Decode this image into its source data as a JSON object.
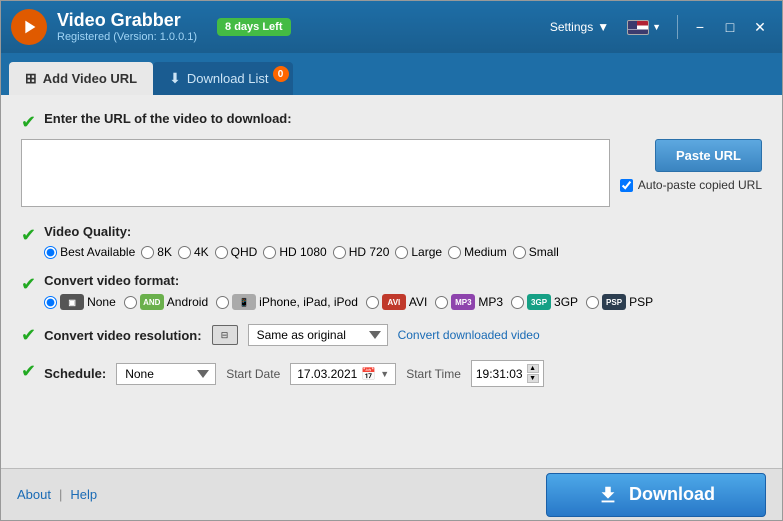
{
  "titlebar": {
    "title": "Video Grabber",
    "subtitle": "Registered (Version: 1.0.0.1)",
    "trial_badge": "8 days Left",
    "settings_label": "Settings",
    "minimize_label": "−",
    "maximize_label": "□",
    "close_label": "✕"
  },
  "tabs": [
    {
      "id": "add-url",
      "label": "Add Video URL",
      "active": true,
      "badge": null
    },
    {
      "id": "download-list",
      "label": "Download List",
      "active": false,
      "badge": "0"
    }
  ],
  "url_section": {
    "label": "Enter the URL of the video to download:",
    "placeholder": "",
    "paste_btn": "Paste URL",
    "auto_paste_label": "Auto-paste copied URL"
  },
  "quality_section": {
    "label": "Video Quality:",
    "options": [
      {
        "id": "best",
        "label": "Best Available",
        "checked": true
      },
      {
        "id": "8k",
        "label": "8K",
        "checked": false
      },
      {
        "id": "4k",
        "label": "4K",
        "checked": false
      },
      {
        "id": "qhd",
        "label": "QHD",
        "checked": false
      },
      {
        "id": "hd1080",
        "label": "HD 1080",
        "checked": false
      },
      {
        "id": "hd720",
        "label": "HD 720",
        "checked": false
      },
      {
        "id": "large",
        "label": "Large",
        "checked": false
      },
      {
        "id": "medium",
        "label": "Medium",
        "checked": false
      },
      {
        "id": "small",
        "label": "Small",
        "checked": false
      }
    ]
  },
  "format_section": {
    "label": "Convert video format:",
    "options": [
      {
        "id": "none",
        "label": "None",
        "icon": "None",
        "icon_class": "none-icon",
        "checked": true
      },
      {
        "id": "android",
        "label": "Android",
        "icon": "AND",
        "icon_class": "android-icon",
        "checked": false
      },
      {
        "id": "iphone",
        "label": "iPhone, iPad, iPod",
        "icon": "iOS",
        "icon_class": "iphone-icon",
        "checked": false
      },
      {
        "id": "avi",
        "label": "AVI",
        "icon": "AVI",
        "icon_class": "avi-icon",
        "checked": false
      },
      {
        "id": "mp3",
        "label": "MP3",
        "icon": "MP3",
        "icon_class": "mp3-icon",
        "checked": false
      },
      {
        "id": "3gp",
        "label": "3GP",
        "icon": "3GP",
        "icon_class": "gp3-icon",
        "checked": false
      },
      {
        "id": "psp",
        "label": "PSP",
        "icon": "PSP",
        "icon_class": "psp-icon",
        "checked": false
      }
    ]
  },
  "resolution_section": {
    "label": "Convert video resolution:",
    "options": [
      {
        "value": "same",
        "label": "Same as original"
      }
    ],
    "selected": "Same as original",
    "convert_link": "Convert downloaded video"
  },
  "schedule_section": {
    "label": "Schedule:",
    "options": [
      {
        "value": "none",
        "label": "None"
      }
    ],
    "selected": "None",
    "start_date_label": "Start Date",
    "start_date_value": "17.03.2021",
    "start_time_label": "Start Time",
    "start_time_value": "19:31:03"
  },
  "bottom_bar": {
    "about_label": "About",
    "help_label": "Help",
    "separator": "|",
    "download_btn": "Download"
  }
}
